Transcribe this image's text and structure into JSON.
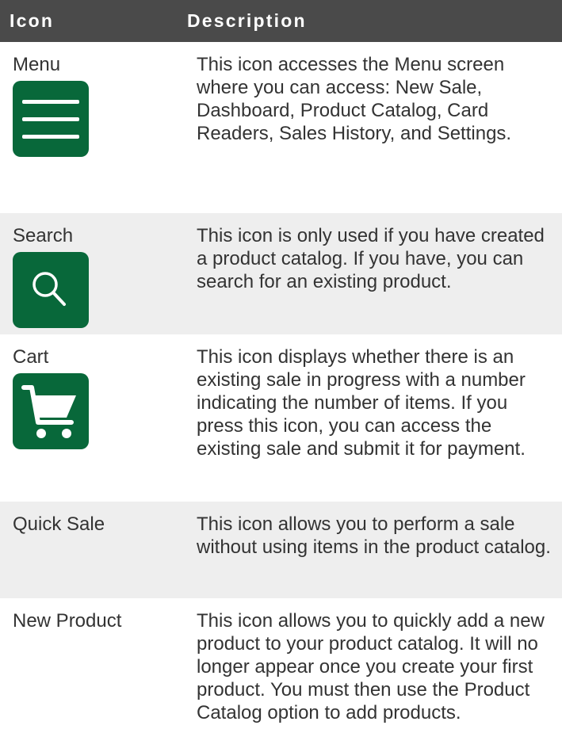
{
  "header": {
    "icon_col": "Icon",
    "desc_col": "Description"
  },
  "rows": [
    {
      "label": "Menu",
      "icon": "menu-icon",
      "description": "This icon accesses the Menu screen where you can access: New Sale, Dashboard, Product Catalog, Card Readers, Sales History, and Settings."
    },
    {
      "label": "Search",
      "icon": "search-icon",
      "description": "This icon is only used if you have created a product catalog. If you have, you can search for an existing product."
    },
    {
      "label": "Cart",
      "icon": "cart-icon",
      "description": "This icon displays whether there is an existing sale in progress with a number indicating the number of items. If you press this icon, you can access the existing sale and submit it for payment."
    },
    {
      "label": "Quick Sale",
      "description": "This icon allows you to perform a sale without using items in the product catalog."
    },
    {
      "label": "New Product",
      "description": "This icon allows you to quickly add a new product to your product catalog. It will no longer appear once you create your first product. You must then use the Product Catalog option to add products."
    }
  ],
  "colors": {
    "header_bg": "#4a4a4a",
    "icon_green": "#08683a",
    "row_shade": "#eeeeee",
    "text": "#333333"
  }
}
